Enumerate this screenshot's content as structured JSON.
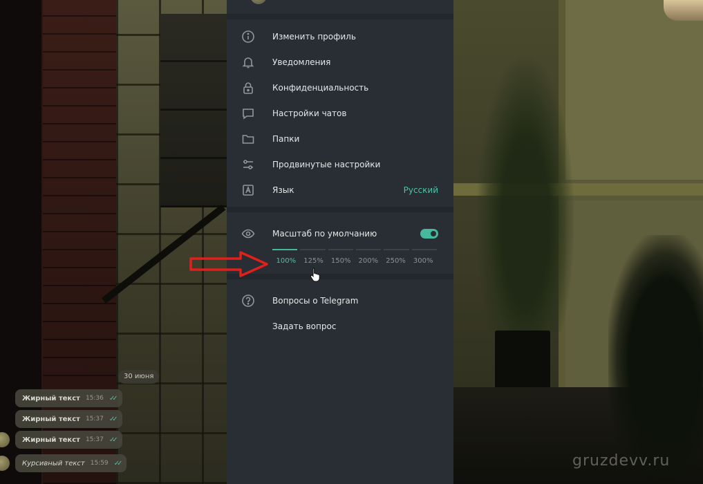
{
  "settings": {
    "items_primary": [
      {
        "label": "Изменить профиль",
        "icon": "info-icon"
      },
      {
        "label": "Уведомления",
        "icon": "bell-icon"
      },
      {
        "label": "Конфиденциальность",
        "icon": "lock-icon"
      },
      {
        "label": "Настройки чатов",
        "icon": "chat-bubble-icon"
      },
      {
        "label": "Папки",
        "icon": "folder-icon"
      },
      {
        "label": "Продвинутые настройки",
        "icon": "sliders-icon"
      },
      {
        "label": "Язык",
        "icon": "language-icon",
        "value": "Русский"
      }
    ],
    "scale": {
      "label": "Масштаб по умолчанию",
      "icon": "eye-icon",
      "toggle_on": true,
      "options": [
        "100%",
        "125%",
        "150%",
        "200%",
        "250%",
        "300%"
      ],
      "selected": "100%"
    },
    "items_secondary": [
      {
        "label": "Вопросы о Telegram",
        "icon": "question-icon"
      },
      {
        "label": "Задать вопрос",
        "icon": ""
      }
    ]
  },
  "chat": {
    "date": "30 июня",
    "messages": [
      {
        "text": "Жирный текст",
        "time": "15:36",
        "style": "bold"
      },
      {
        "text": "Жирный текст",
        "time": "15:37",
        "style": "bold"
      },
      {
        "text": "Жирный текст",
        "time": "15:37",
        "style": "bold"
      },
      {
        "text": "Курсивный текст",
        "time": "15:59",
        "style": "italic"
      }
    ]
  },
  "watermark": "gruzdevv.ru",
  "colors": {
    "panel_bg": "#282e33",
    "accent": "#4fc1a8",
    "annotation_arrow": "#e0201c"
  }
}
